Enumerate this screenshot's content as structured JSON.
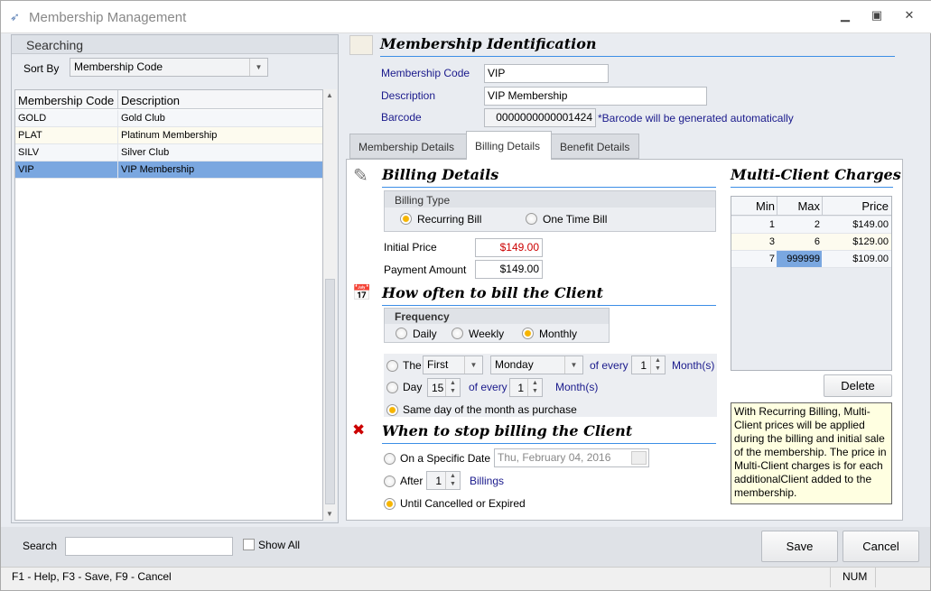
{
  "window": {
    "title": "Membership Management",
    "app_icon": "bird-icon"
  },
  "search_panel": {
    "title": "Searching",
    "sort_by_label": "Sort By",
    "sort_by_value": "Membership Code",
    "columns": [
      "Membership Code",
      "Description"
    ],
    "rows": [
      {
        "code": "GOLD",
        "description": "Gold Club"
      },
      {
        "code": "PLAT",
        "description": "Platinum Membership"
      },
      {
        "code": "SILV",
        "description": "Silver Club"
      },
      {
        "code": "VIP",
        "description": "VIP Membership",
        "selected": true
      }
    ]
  },
  "identification": {
    "title": "Membership Identification",
    "code_label": "Membership Code",
    "code_value": "VIP",
    "description_label": "Description",
    "description_value": "VIP Membership",
    "barcode_label": "Barcode",
    "barcode_value": "0000000000001424",
    "barcode_note": "*Barcode will be generated automatically"
  },
  "tabs": [
    {
      "label": "Membership Details"
    },
    {
      "label": "Billing Details",
      "active": true
    },
    {
      "label": "Benefit Details"
    }
  ],
  "billing": {
    "title": "Billing Details",
    "billing_type_label": "Billing Type",
    "recurring": "Recurring Bill",
    "one_time": "One Time Bill",
    "selected_type": "Recurring Bill",
    "initial_price_label": "Initial Price",
    "initial_price": "$149.00",
    "payment_amount_label": "Payment Amount",
    "payment_amount": "$149.00"
  },
  "frequency": {
    "title": "How often to bill the Client",
    "group_label": "Frequency",
    "daily": "Daily",
    "weekly": "Weekly",
    "monthly": "Monthly",
    "selected": "Monthly",
    "the_label": "The",
    "the_ordinal": "First",
    "the_day": "Monday",
    "of_every": "of every",
    "the_interval": "1",
    "months": "Month(s)",
    "day_label": "Day",
    "day_value": "15",
    "day_interval": "1",
    "same_day": "Same day of the month as purchase",
    "selected_option": "same_day"
  },
  "stop": {
    "title": "When to stop billing the Client",
    "specific_date": "On a Specific Date",
    "date_value": "Thu, February 04, 2016",
    "after": "After",
    "after_value": "1",
    "billings": "Billings",
    "until": "Until Cancelled or Expired",
    "selected": "until"
  },
  "multi_client": {
    "title": "Multi-Client Charges",
    "columns": [
      "Min",
      "Max",
      "Price"
    ],
    "rows": [
      {
        "min": "1",
        "max": "2",
        "price": "$149.00"
      },
      {
        "min": "3",
        "max": "6",
        "price": "$129.00"
      },
      {
        "min": "7",
        "max": "999999",
        "price": "$109.00"
      }
    ],
    "delete_label": "Delete",
    "note": "With Recurring Billing, Multi-Client prices will be applied during the billing and initial sale of the membership. The price in Multi-Client charges is for each additionalClient added to the membership."
  },
  "footer": {
    "search_label": "Search",
    "search_value": "",
    "show_all": "Show All",
    "save": "Save",
    "cancel": "Cancel"
  },
  "statusbar": {
    "hint": "F1 - Help, F3 - Save, F9 - Cancel",
    "num": "NUM"
  },
  "colors": {
    "accent_line": "#3c8ee6",
    "selection": "#7aa7e0",
    "radio_selected": "#f6b400",
    "label_blue": "#1a1a8c"
  }
}
